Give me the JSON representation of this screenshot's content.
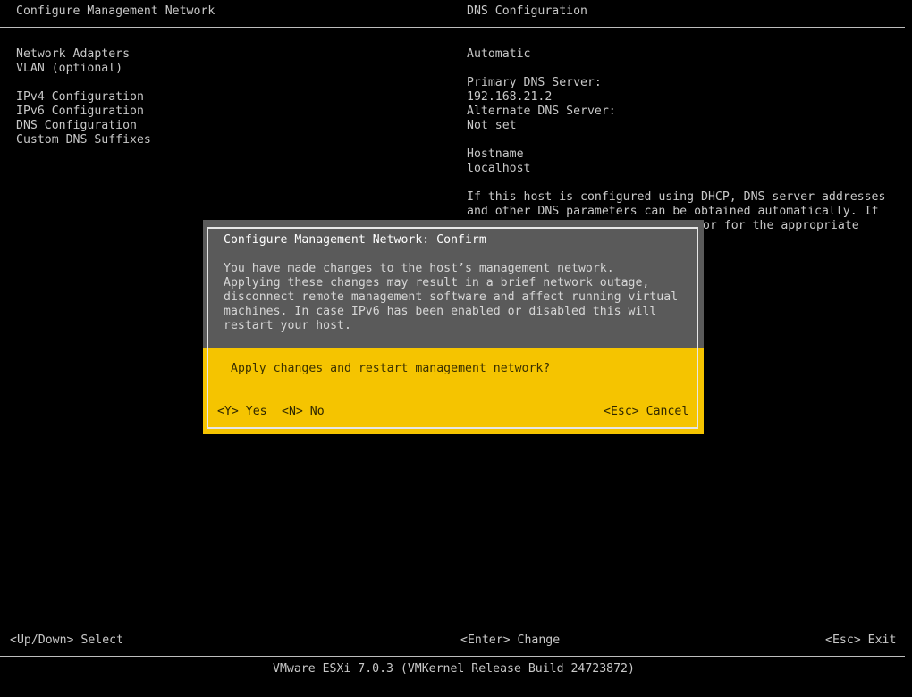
{
  "header": {
    "left_title": "Configure Management Network",
    "right_title": "DNS Configuration"
  },
  "menu": {
    "items": [
      "Network Adapters",
      "VLAN (optional)",
      "IPv4 Configuration",
      "IPv6 Configuration",
      "DNS Configuration",
      "Custom DNS Suffixes"
    ]
  },
  "details": {
    "mode": "Automatic",
    "primary_dns_label": "Primary DNS Server:",
    "primary_dns_value": "192.168.21.2",
    "alternate_dns_label": "Alternate DNS Server:",
    "alternate_dns_value": "Not set",
    "hostname_label": "Hostname",
    "hostname_value": "localhost",
    "help_lines": [
      "If this host is configured using DHCP, DNS server addresses",
      "and other DNS parameters can be obtained automatically. If",
      "or for the appropriate"
    ]
  },
  "dialog": {
    "title": "Configure Management Network: Confirm",
    "body_lines": [
      "You have made changes to the host’s management network.",
      "Applying these changes may result in a brief network outage,",
      "disconnect remote management software and affect running virtual",
      "machines. In case IPv6 has been enabled or disabled this will",
      "restart your host."
    ],
    "question": "Apply changes and restart management network?",
    "yes_label": "<Y> Yes",
    "no_label": "<N> No",
    "cancel_label": "<Esc> Cancel"
  },
  "footer": {
    "left_hint": "<Up/Down> Select",
    "mid_hint": "<Enter> Change",
    "right_hint": "<Esc> Exit",
    "version": "VMware ESXi 7.0.3 (VMKernel Release Build 24723872)"
  },
  "colors": {
    "background": "#000000",
    "text": "#c8c8c8",
    "dialog_upper": "#5a5a5a",
    "dialog_lower": "#f5c400"
  }
}
